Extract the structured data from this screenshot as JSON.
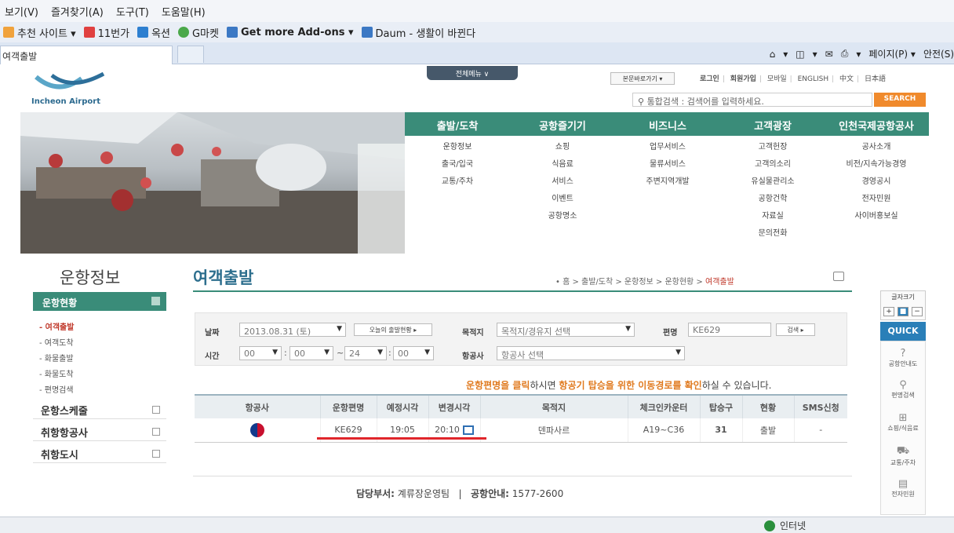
{
  "browser": {
    "menu": [
      "보기(V)",
      "즐겨찾기(A)",
      "도구(T)",
      "도움말(H)"
    ],
    "favorites": [
      {
        "label": "추천 사이트 ▾",
        "color": "#f0a23c"
      },
      {
        "label": "11번가",
        "color": "#e04040"
      },
      {
        "label": "옥션",
        "color": "#2d7fd0"
      },
      {
        "label": "G마켓",
        "color": "#4aa84a"
      },
      {
        "label": "Get more Add-ons ▾",
        "color": "#3b78c4"
      },
      {
        "label": "Daum - 생활이 바뀐다",
        "color": "#3b78c4"
      }
    ],
    "tab_title": "여객출발",
    "commands": [
      "▾",
      "▾",
      "▾",
      "▾",
      "페이지(P) ▾",
      "안전(S)"
    ],
    "status_zone": "인터넷"
  },
  "site": {
    "logo_text": "Incheon Airport",
    "all_menu": "전체메뉴 ∨",
    "skip_nav": "본문바로가기 ▾",
    "util_links": [
      "로그인",
      "회원가입",
      "모바일",
      "ENGLISH",
      "中文",
      "日本語"
    ],
    "search_placeholder": "통합검색 : 검색어를 입력하세요.",
    "search_button": "SEARCH"
  },
  "gnb": [
    {
      "title": "출발/도착",
      "items": [
        "운항정보",
        "출국/입국",
        "교통/주차"
      ]
    },
    {
      "title": "공항즐기기",
      "items": [
        "쇼핑",
        "식음료",
        "서비스",
        "이벤트",
        "공항명소"
      ]
    },
    {
      "title": "비즈니스",
      "items": [
        "업무서비스",
        "물류서비스",
        "주변지역개발"
      ]
    },
    {
      "title": "고객광장",
      "items": [
        "고객헌장",
        "고객의소리",
        "유실물관리소",
        "공항건학",
        "자료실",
        "문의전화"
      ]
    },
    {
      "title": "인천국제공항공사",
      "items": [
        "공사소개",
        "비전/지속가능경영",
        "경영공시",
        "전자민원",
        "사이버홍보실"
      ]
    }
  ],
  "sidebar": {
    "title": "운항정보",
    "current": "운항현황",
    "subs": [
      "- 여객출발",
      "- 여객도착",
      "- 화물출발",
      "- 화물도착",
      "- 편명검색"
    ],
    "mains": [
      "운항스케줄",
      "취항항공사",
      "취항도시"
    ]
  },
  "content": {
    "title": "여객출발",
    "breadcrumb": "• 홈 > 출발/도착 > 운항정보 > 운항현황 > ",
    "breadcrumb_current": "여객출발"
  },
  "filter": {
    "date_label": "날짜",
    "date_value": "2013.08.31 (토)",
    "today_button": "오늘의 출발현황 ▸",
    "dest_label": "목적지",
    "dest_value": "목적지/경유지 선택",
    "flight_label": "편명",
    "flight_value": "KE629",
    "search_button": "검색 ▸",
    "time_label": "시간",
    "time_from_h": "00",
    "time_from_m": "00",
    "time_to_h": "24",
    "time_to_m": "00",
    "colon": ":",
    "tilde": "~",
    "airline_label": "항공사",
    "airline_value": "항공사 선택"
  },
  "notice": {
    "p1": "운항편명을 클릭",
    "p2": "하시면 ",
    "p3": "항공기 탑승을 위한 이동경로를 확인",
    "p4": "하실 수 있습니다."
  },
  "table": {
    "headers": [
      "항공사",
      "운항편명",
      "예정시각",
      "변경시각",
      "목적지",
      "체크인카운터",
      "탑승구",
      "현황",
      "SMS신청"
    ],
    "row": {
      "flight": "KE629",
      "scheduled": "19:05",
      "changed": "20:10",
      "destination": "덴파사르",
      "checkin": "A19~C36",
      "gate": "31",
      "status": "출발",
      "sms": "-"
    }
  },
  "footer": {
    "dept_label": "담당부서:",
    "dept": "계류장운영팀",
    "sep": "|",
    "info_label": "공항안내:",
    "phone": "1577-2600"
  },
  "rail": {
    "font_label": "글자크기",
    "quick": "QUICK",
    "items": [
      "공항안내도",
      "편명검색",
      "쇼핑/식음료",
      "교통/주차",
      "전자민원"
    ]
  },
  "colors": {
    "brand_green": "#3a8c79",
    "accent_orange": "#f08a2c",
    "highlight_red": "#e0262b"
  }
}
